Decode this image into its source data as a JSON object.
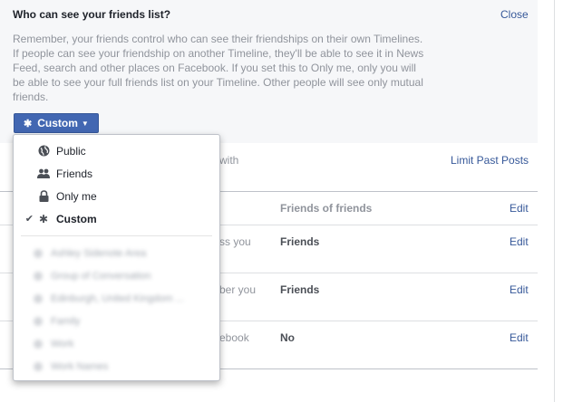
{
  "dialog": {
    "question": "Who can see your friends list?",
    "close_label": "Close",
    "description": "Remember, your friends control who can see their friendships on their own Timelines. If people can see your friendship on another Timeline, they'll be able to see it in News Feed, search and other places on Facebook. If you set this to Only me, only you will be able to see your full friends list on your Timeline. Other people will see only mutual friends.",
    "audience_button": {
      "label": "Custom",
      "icon": "gear-icon"
    }
  },
  "menu": {
    "items": [
      {
        "label": "Public",
        "icon": "globe-icon",
        "selected": false
      },
      {
        "label": "Friends",
        "icon": "friends-icon",
        "selected": false
      },
      {
        "label": "Only me",
        "icon": "lock-icon",
        "selected": false
      },
      {
        "label": "Custom",
        "icon": "gear-icon",
        "selected": true
      }
    ],
    "blurred_items": [
      "Ashley Sidenote Area",
      "Group of Conversation",
      "Edinburgh, United Kingdom ...",
      "Family",
      "Work",
      "Work Names"
    ]
  },
  "background": {
    "row1_fragment": "with",
    "limit_past_posts": "Limit Past Posts",
    "column_header": "Friends of friends",
    "rows": [
      {
        "fragment": "ss you",
        "value": "Friends",
        "edit": "Edit"
      },
      {
        "fragment": "ber you",
        "value": "Friends",
        "edit": "Edit"
      },
      {
        "fragment": "ebook",
        "value": "No",
        "edit": "Edit"
      }
    ],
    "header_edit": "Edit"
  }
}
